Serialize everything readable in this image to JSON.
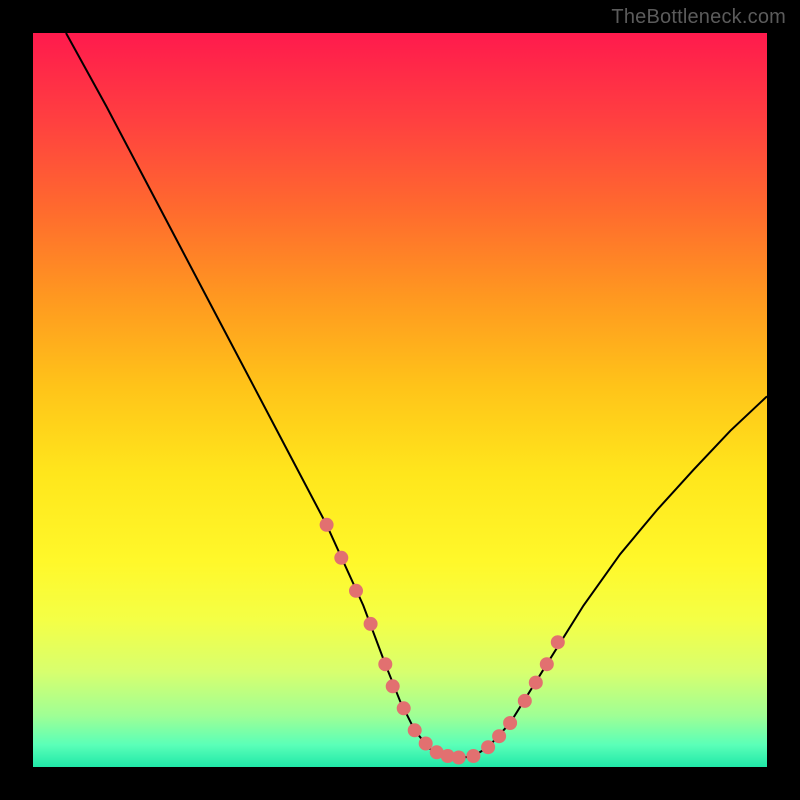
{
  "watermark": "TheBottleneck.com",
  "chart_data": {
    "type": "line",
    "title": "",
    "xlabel": "",
    "ylabel": "",
    "xlim": [
      0,
      100
    ],
    "ylim": [
      0,
      100
    ],
    "series": [
      {
        "name": "curve",
        "x": [
          4.5,
          10,
          15,
          20,
          25,
          30,
          35,
          40,
          45,
          48,
          50,
          52,
          54,
          56,
          58,
          60,
          62,
          65,
          70,
          75,
          80,
          85,
          90,
          95,
          100
        ],
        "values": [
          100,
          90,
          80.5,
          71,
          61.5,
          52,
          42.5,
          33,
          22,
          14,
          9,
          5,
          2.5,
          1.5,
          1.2,
          1.5,
          2.7,
          6,
          14,
          22,
          29,
          35,
          40.5,
          45.8,
          50.5
        ]
      }
    ],
    "markers": {
      "name": "highlight-dots",
      "color": "#e27070",
      "x": [
        40,
        42,
        44,
        46,
        48,
        49,
        50.5,
        52,
        53.5,
        55,
        56.5,
        58,
        60,
        62,
        63.5,
        65,
        67,
        68.5,
        70,
        71.5
      ],
      "values": [
        33,
        28.5,
        24,
        19.5,
        14,
        11,
        8,
        5,
        3.2,
        2,
        1.5,
        1.3,
        1.5,
        2.7,
        4.2,
        6,
        9,
        11.5,
        14,
        17
      ]
    }
  }
}
